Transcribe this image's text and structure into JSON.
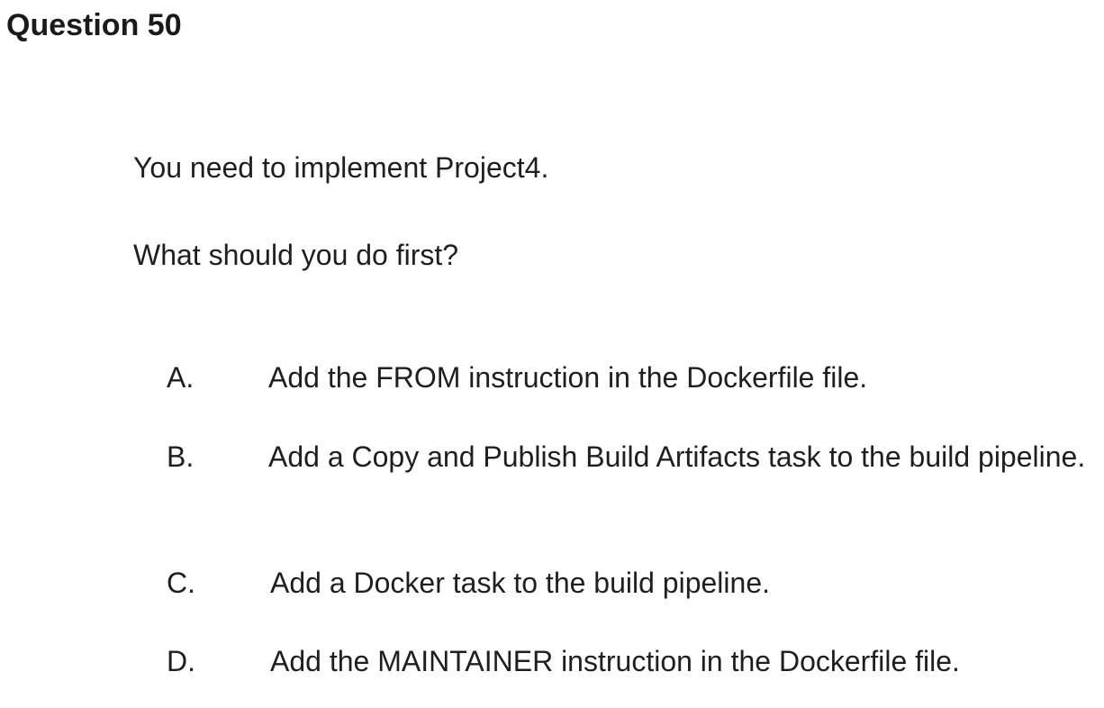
{
  "question": {
    "title": "Question 50",
    "stem": [
      "You need to implement Project4.",
      "What should you do first?"
    ],
    "options": [
      {
        "letter": "A.",
        "text": "Add the FROM instruction in the Dockerfile file."
      },
      {
        "letter": "B.",
        "text": "Add a Copy and Publish Build Artifacts task to the build pipeline."
      },
      {
        "letter": "C.",
        "text": "Add a Docker task to the build pipeline."
      },
      {
        "letter": "D.",
        "text": "Add the MAINTAINER instruction in the Dockerfile file."
      }
    ]
  }
}
